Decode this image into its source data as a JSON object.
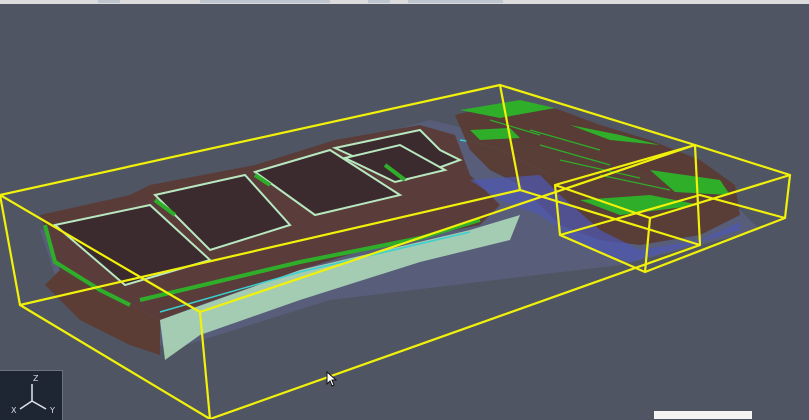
{
  "viewport": {
    "background": "#4f5562",
    "bounding_box_color": "#f1f10a",
    "building_colors": [
      "#5a3b34",
      "#2fae2a",
      "#b8e8c0",
      "#6a6fae"
    ]
  },
  "axis_widget": {
    "z_label": "Z",
    "x_label": "X",
    "y_label": "Y"
  },
  "status_bar": {
    "text": ""
  },
  "icons": {
    "cursor": "mouse-pointer-icon",
    "orientation": "axis-triad-icon"
  }
}
